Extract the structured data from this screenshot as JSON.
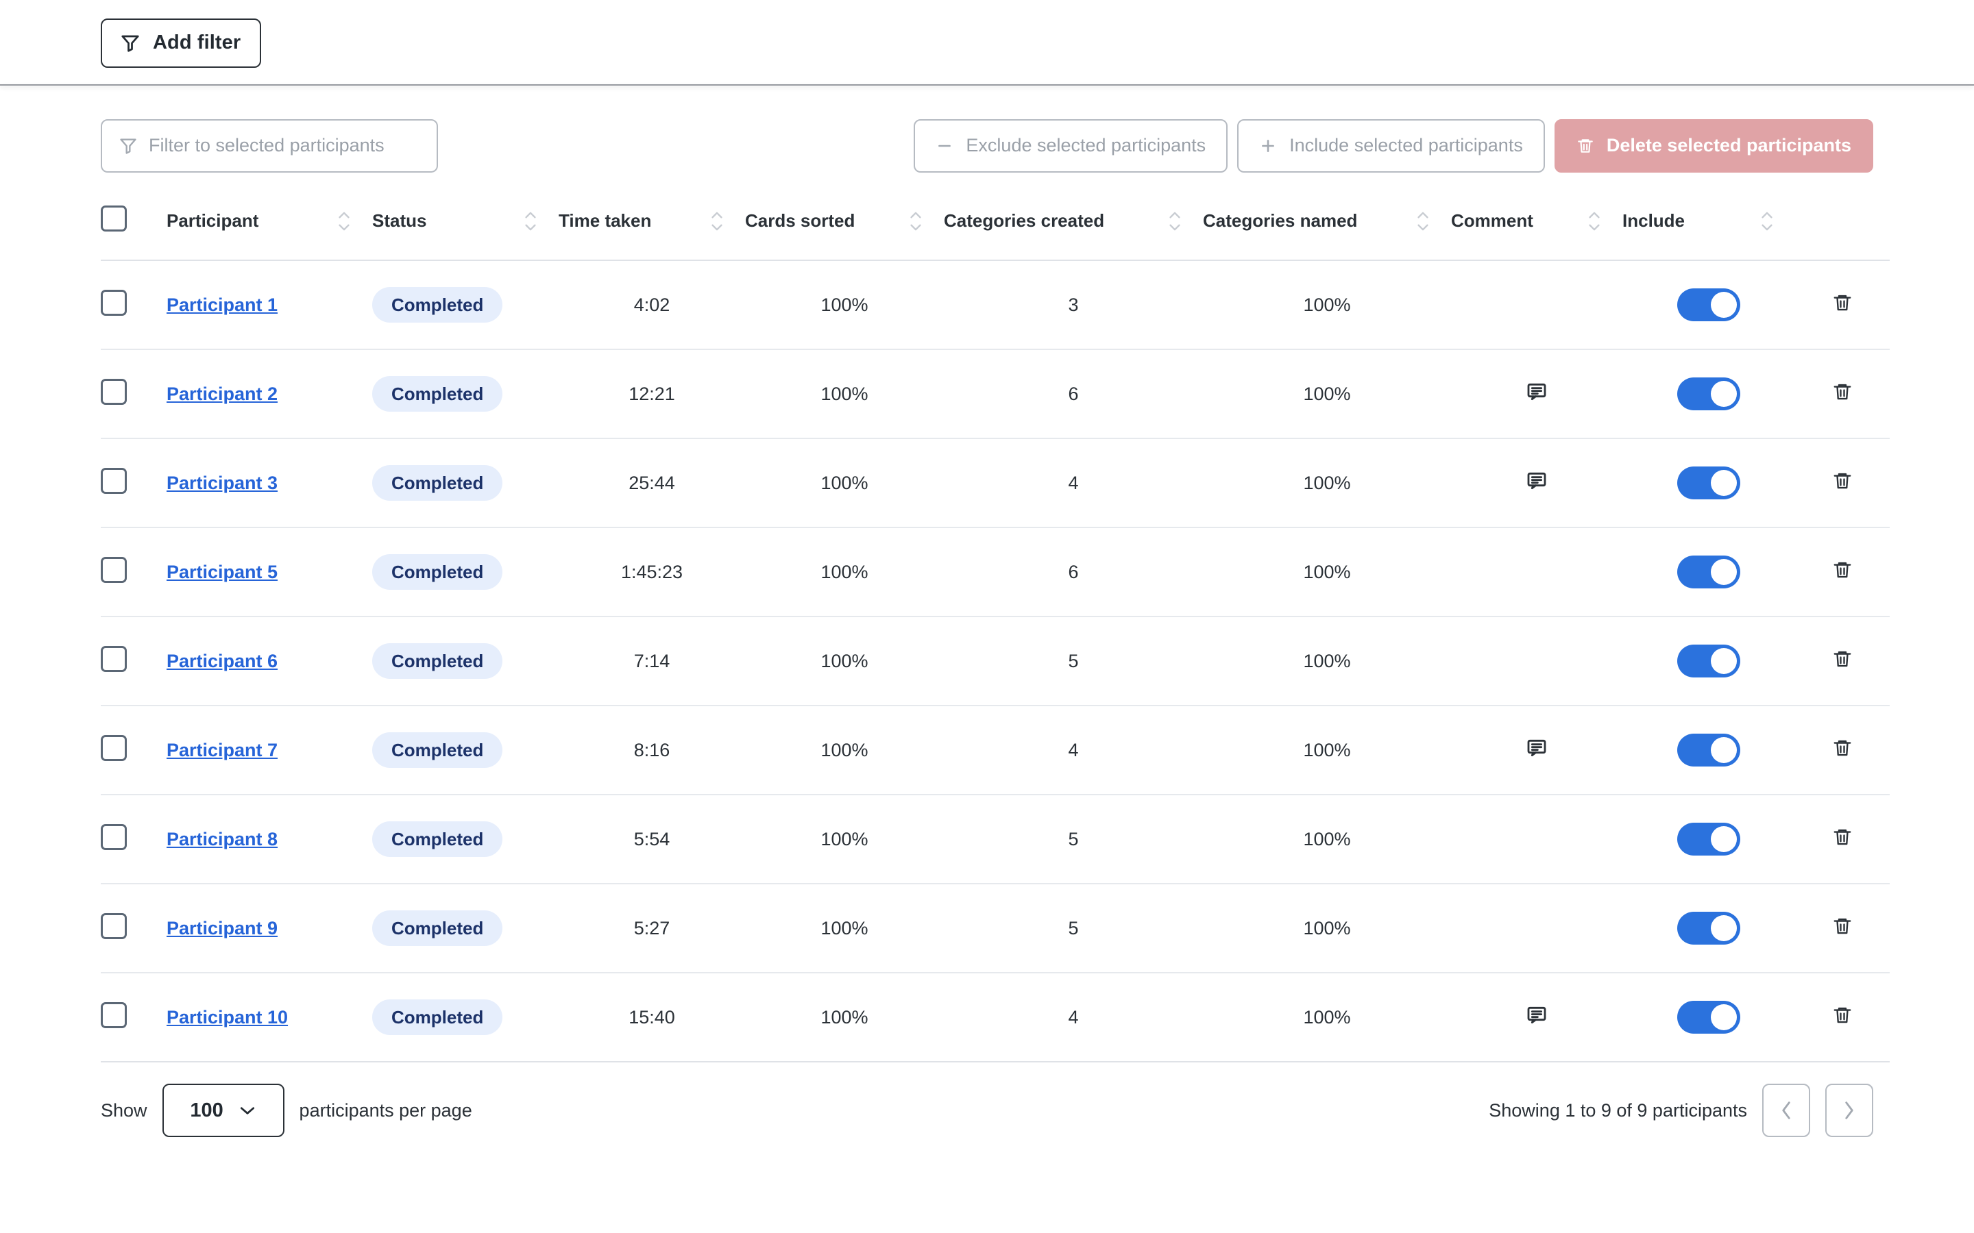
{
  "topbar": {
    "add_filter_label": "Add filter"
  },
  "toolbar": {
    "filter_placeholder": "Filter to selected participants",
    "exclude_label": "Exclude selected participants",
    "include_label": "Include selected participants",
    "delete_label": "Delete selected participants",
    "delete_bg": "#e0a3a6"
  },
  "table": {
    "columns": [
      {
        "key": "participant",
        "label": "Participant",
        "sortable": true
      },
      {
        "key": "status",
        "label": "Status",
        "sortable": true
      },
      {
        "key": "time_taken",
        "label": "Time taken",
        "sortable": true
      },
      {
        "key": "cards_sorted",
        "label": "Cards sorted",
        "sortable": true
      },
      {
        "key": "categories_created",
        "label": "Categories created",
        "sortable": true
      },
      {
        "key": "categories_named",
        "label": "Categories named",
        "sortable": true
      },
      {
        "key": "comment",
        "label": "Comment",
        "sortable": true
      },
      {
        "key": "include",
        "label": "Include",
        "sortable": true
      }
    ],
    "rows": [
      {
        "participant": "Participant 1",
        "status": "Completed",
        "time_taken": "4:02",
        "cards_sorted": "100%",
        "categories_created": "3",
        "categories_named": "100%",
        "has_comment": false,
        "include": true
      },
      {
        "participant": "Participant 2",
        "status": "Completed",
        "time_taken": "12:21",
        "cards_sorted": "100%",
        "categories_created": "6",
        "categories_named": "100%",
        "has_comment": true,
        "include": true
      },
      {
        "participant": "Participant 3",
        "status": "Completed",
        "time_taken": "25:44",
        "cards_sorted": "100%",
        "categories_created": "4",
        "categories_named": "100%",
        "has_comment": true,
        "include": true
      },
      {
        "participant": "Participant 5",
        "status": "Completed",
        "time_taken": "1:45:23",
        "cards_sorted": "100%",
        "categories_created": "6",
        "categories_named": "100%",
        "has_comment": false,
        "include": true
      },
      {
        "participant": "Participant 6",
        "status": "Completed",
        "time_taken": "7:14",
        "cards_sorted": "100%",
        "categories_created": "5",
        "categories_named": "100%",
        "has_comment": false,
        "include": true
      },
      {
        "participant": "Participant 7",
        "status": "Completed",
        "time_taken": "8:16",
        "cards_sorted": "100%",
        "categories_created": "4",
        "categories_named": "100%",
        "has_comment": true,
        "include": true
      },
      {
        "participant": "Participant 8",
        "status": "Completed",
        "time_taken": "5:54",
        "cards_sorted": "100%",
        "categories_created": "5",
        "categories_named": "100%",
        "has_comment": false,
        "include": true
      },
      {
        "participant": "Participant 9",
        "status": "Completed",
        "time_taken": "5:27",
        "cards_sorted": "100%",
        "categories_created": "5",
        "categories_named": "100%",
        "has_comment": false,
        "include": true
      },
      {
        "participant": "Participant 10",
        "status": "Completed",
        "time_taken": "15:40",
        "cards_sorted": "100%",
        "categories_created": "4",
        "categories_named": "100%",
        "has_comment": true,
        "include": true
      }
    ]
  },
  "footer": {
    "show_label": "Show",
    "page_size": "100",
    "per_page_label": "participants per page",
    "showing_text": "Showing 1 to 9 of 9 participants"
  },
  "colors": {
    "link": "#2664d8",
    "toggle_on": "#2b72dd",
    "badge_bg": "#e6eefc",
    "badge_text": "#1c3269",
    "danger": "#e0a3a6"
  },
  "icons": {
    "filter": "filter-icon",
    "minus": "minus-icon",
    "plus": "plus-icon",
    "trash": "trash-icon",
    "comment": "comment-icon",
    "sort": "sort-icon",
    "chevron_down": "chevron-down-icon",
    "chevron_left": "chevron-left-icon",
    "chevron_right": "chevron-right-icon"
  }
}
